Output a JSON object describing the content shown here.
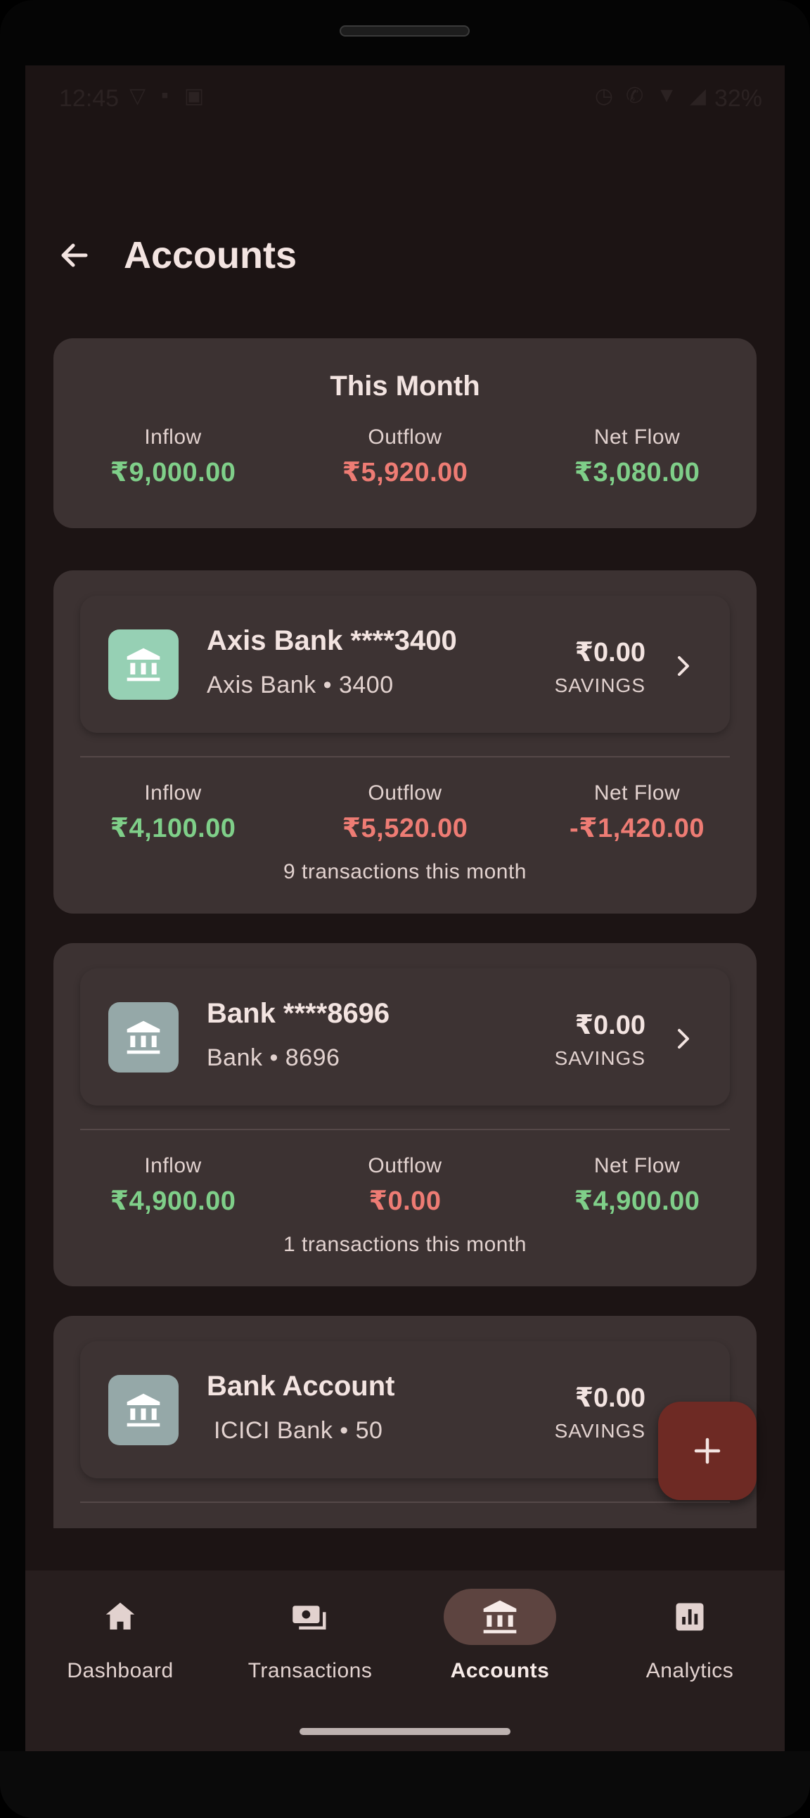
{
  "status_bar": {
    "time": "12:45",
    "battery": "32%",
    "left_icons": [
      "vpn-icon",
      "card-icon",
      "cast-icon"
    ],
    "right_icons": [
      "alarm-icon",
      "wifi-call-icon",
      "wifi-icon",
      "signal-icon",
      "battery-icon"
    ]
  },
  "app_bar": {
    "title": "Accounts"
  },
  "summary": {
    "title": "This Month",
    "inflow_label": "Inflow",
    "inflow": "₹9,000.00",
    "outflow_label": "Outflow",
    "outflow": "₹5,920.00",
    "net_label": "Net Flow",
    "net": "₹3,080.00"
  },
  "accounts": [
    {
      "name": "Axis Bank ****3400",
      "subtitle": "Axis Bank • 3400",
      "balance": "₹0.00",
      "type": "SAVINGS",
      "icon_color": "#96d0b4",
      "inflow_label": "Inflow",
      "inflow": "₹4,100.00",
      "outflow_label": "Outflow",
      "outflow": "₹5,520.00",
      "net_label": "Net Flow",
      "net": "-₹1,420.00",
      "tx_count": "9 transactions this month"
    },
    {
      "name": "Bank ****8696",
      "subtitle": "Bank • 8696",
      "balance": "₹0.00",
      "type": "SAVINGS",
      "icon_color": "#95a8a8",
      "inflow_label": "Inflow",
      "inflow": "₹4,900.00",
      "outflow_label": "Outflow",
      "outflow": "₹0.00",
      "net_label": "Net Flow",
      "net": "₹4,900.00",
      "tx_count": "1 transactions this month"
    },
    {
      "name": "Bank Account",
      "subtitle": " ICICI Bank • 50",
      "balance": "₹0.00",
      "type": "SAVINGS",
      "icon_color": "#95a8a8"
    }
  ],
  "fab": {
    "icon": "plus-icon"
  },
  "nav": {
    "items": [
      {
        "label": "Dashboard",
        "icon": "home-icon"
      },
      {
        "label": "Transactions",
        "icon": "payments-icon"
      },
      {
        "label": "Accounts",
        "icon": "bank-icon",
        "active": true
      },
      {
        "label": "Analytics",
        "icon": "analytics-icon"
      }
    ]
  },
  "colors": {
    "background": "#1c1414",
    "card": "#3c3232",
    "positive": "#7fcf89",
    "negative": "#ee7c74",
    "fab": "#6e2a24",
    "nav_active": "#5d4440"
  }
}
